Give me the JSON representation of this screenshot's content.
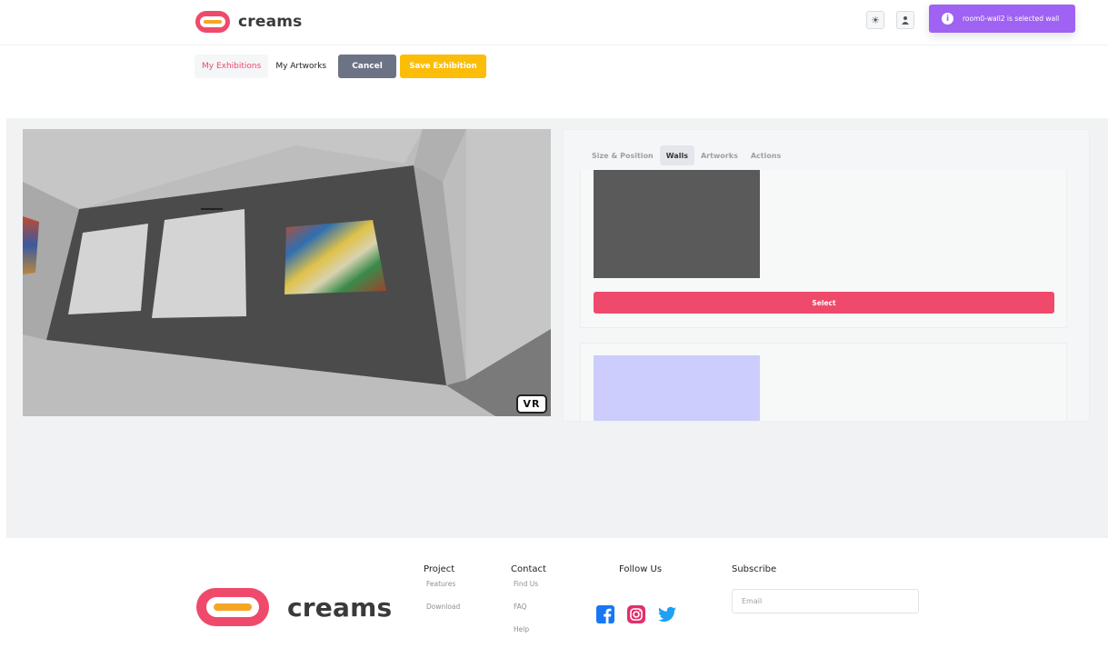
{
  "brand": {
    "name": "creams"
  },
  "header": {
    "theme_icon": "sun-icon",
    "user_icon": "user-icon",
    "toast": "room0-wall2 is selected wall"
  },
  "nav": {
    "my_exhibitions": "My Exhibitions",
    "my_artworks": "My Artworks",
    "cancel": "Cancel",
    "save": "Save Exhibition"
  },
  "viewer": {
    "vr_label": "VR"
  },
  "panel": {
    "tabs": [
      "Size & Position",
      "Walls",
      "Artworks",
      "Actions"
    ],
    "active_tab": "Walls",
    "walls": [
      {
        "color": "#5a5a5a",
        "select_label": "Select"
      },
      {
        "color": "#cccdfc"
      }
    ]
  },
  "footer": {
    "project": {
      "title": "Project",
      "links": [
        "Features",
        "Download"
      ]
    },
    "contact": {
      "title": "Contact",
      "links": [
        "Find Us",
        "FAQ",
        "Help"
      ]
    },
    "follow": {
      "title": "Follow Us",
      "icons": [
        "facebook-icon",
        "instagram-icon",
        "twitter-icon"
      ]
    },
    "subscribe": {
      "title": "Subscribe",
      "email_placeholder": "Email"
    }
  },
  "colors": {
    "accent": "#ef4a6b",
    "warning": "#fbbd08",
    "toast": "#9f62f3",
    "cancel": "#6c7384"
  }
}
